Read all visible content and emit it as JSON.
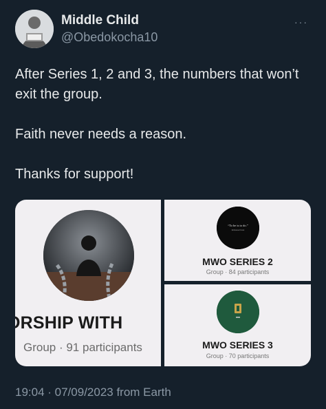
{
  "author": {
    "display_name": "Middle Child",
    "handle": "@Obedokocha10"
  },
  "more_menu": "···",
  "tweet": {
    "lines": [
      "After Series 1, 2 and 3, the numbers that won’t exit the group.",
      "Faith never needs a reason.",
      "Thanks for support!"
    ]
  },
  "media": {
    "cards": [
      {
        "title": "ORSHIP WITH",
        "subtitle": "Group · 91 participants"
      },
      {
        "title": "MWO SERIES 2",
        "subtitle": "Group · 84 participants",
        "circle_text": "“To be is to do.”",
        "circle_subtext": "Immanuel Kant"
      },
      {
        "title": "MWO SERIES 3",
        "subtitle": "Group · 70 participants"
      }
    ]
  },
  "footer": {
    "timestamp": "19:04 · 07/09/2023 from Earth"
  },
  "colors": {
    "background": "#15202b",
    "text_primary": "#e7e9ea",
    "text_secondary": "#8b98a5",
    "card_bg": "#f1eff2"
  }
}
